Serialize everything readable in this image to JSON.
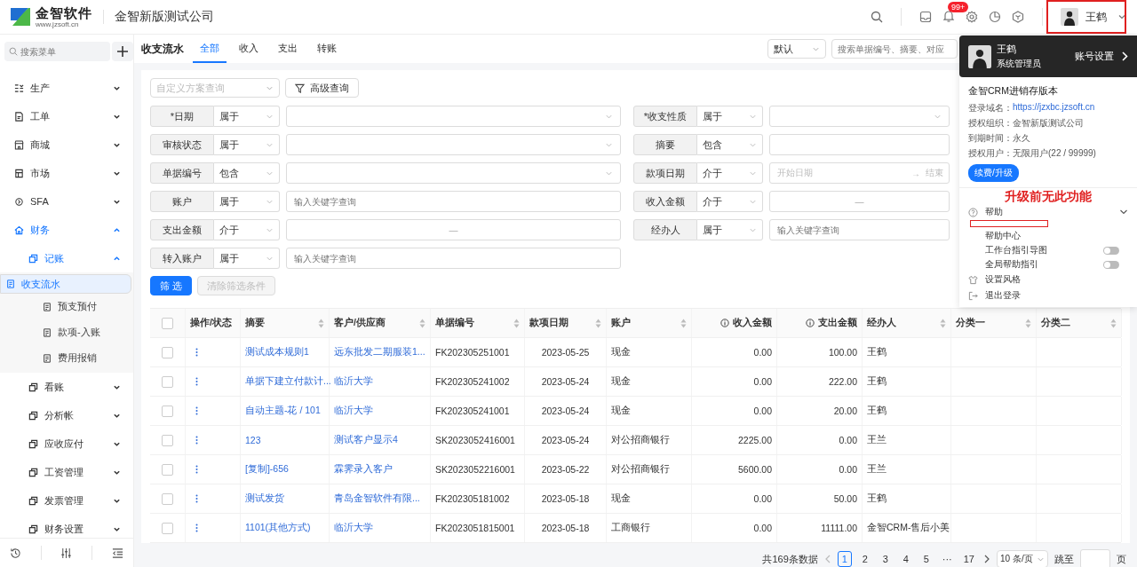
{
  "header": {
    "brand": "金智软件",
    "brand_url": "www.jzsoft.cn",
    "company": "金智新版测试公司",
    "notification_badge": "99+",
    "user": "王鹤"
  },
  "sidebar": {
    "search_placeholder": "搜索菜单",
    "items": [
      {
        "label": "生产",
        "expanded": false
      },
      {
        "label": "工单",
        "expanded": false
      },
      {
        "label": "商城",
        "expanded": false
      },
      {
        "label": "市场",
        "expanded": false
      },
      {
        "label": "SFA",
        "expanded": false
      },
      {
        "label": "财务",
        "expanded": true,
        "children": [
          {
            "label": "记账",
            "expanded": true,
            "children": [
              {
                "label": "收支流水",
                "selected": true
              },
              {
                "label": "预支预付",
                "selected": false
              },
              {
                "label": "款项-入账",
                "selected": false
              },
              {
                "label": "费用报销",
                "selected": false
              }
            ]
          },
          {
            "label": "看账",
            "expanded": false
          },
          {
            "label": "分析帐",
            "expanded": false
          },
          {
            "label": "应收应付",
            "expanded": false
          },
          {
            "label": "工资管理",
            "expanded": false
          },
          {
            "label": "发票管理",
            "expanded": false
          },
          {
            "label": "财务设置",
            "expanded": false
          }
        ]
      }
    ]
  },
  "page": {
    "title": "收支流水",
    "tabs": [
      {
        "label": "全部",
        "selected": true
      },
      {
        "label": "收入",
        "selected": false
      },
      {
        "label": "支出",
        "selected": false
      },
      {
        "label": "转账",
        "selected": false
      }
    ],
    "sort_select": "默认",
    "search_placeholder": "搜索单据编号、摘要、对应"
  },
  "filter": {
    "scheme_placeholder": "自定义方案查询",
    "advanced_button": "高级查询",
    "left": [
      {
        "label": "*日期",
        "operator": "属于",
        "kind": "select"
      },
      {
        "label": "审核状态",
        "operator": "属于",
        "kind": "select"
      },
      {
        "label": "单据编号",
        "operator": "包含",
        "kind": "select"
      },
      {
        "label": "账户",
        "operator": "属于",
        "kind": "input",
        "placeholder": "输入关键字查询"
      },
      {
        "label": "支出金额",
        "operator": "介于",
        "kind": "range",
        "separator": "—"
      },
      {
        "label": "转入账户",
        "operator": "属于",
        "kind": "input",
        "placeholder": "输入关键字查询"
      }
    ],
    "right": [
      {
        "label": "*收支性质",
        "operator": "属于",
        "kind": "select"
      },
      {
        "label": "摘要",
        "operator": "包含",
        "kind": "input"
      },
      {
        "label": "款项日期",
        "operator": "介于",
        "kind": "date",
        "start_placeholder": "开始日期",
        "separator": "→",
        "end_placeholder": "结束"
      },
      {
        "label": "收入金额",
        "operator": "介于",
        "kind": "range",
        "separator": "—"
      },
      {
        "label": "经办人",
        "operator": "属于",
        "kind": "input",
        "placeholder": "输入关键字查询"
      }
    ],
    "apply_button": "筛 选",
    "clear_button": {
      "label": "清除筛选条件",
      "disabled": true
    }
  },
  "table": {
    "all_checked": false,
    "columns": [
      {
        "label": "操作/状态",
        "sortable": false,
        "info": false
      },
      {
        "label": "摘要",
        "sortable": true,
        "info": false
      },
      {
        "label": "客户/供应商",
        "sortable": true,
        "info": false
      },
      {
        "label": "单据编号",
        "sortable": true,
        "info": false
      },
      {
        "label": "款项日期",
        "sortable": true,
        "info": false
      },
      {
        "label": "账户",
        "sortable": true,
        "info": false
      },
      {
        "label": "收入金额",
        "sortable": false,
        "info": true
      },
      {
        "label": "支出金额",
        "sortable": false,
        "info": true
      },
      {
        "label": "经办人",
        "sortable": true,
        "info": false
      },
      {
        "label": "分类一",
        "sortable": true,
        "info": false
      },
      {
        "label": "分类二",
        "sortable": true,
        "info": false
      }
    ],
    "rows": [
      {
        "checked": false,
        "cells": [
          "",
          "测试成本规则1",
          "远东批发二期服装1...",
          "FK202305251001",
          "2023-05-25",
          "现金",
          "0.00",
          "100.00",
          "王鹤"
        ]
      },
      {
        "checked": false,
        "cells": [
          "",
          "单据下建立付款计...",
          "临沂大学",
          "FK202305241002",
          "2023-05-24",
          "现金",
          "0.00",
          "222.00",
          "王鹤"
        ]
      },
      {
        "checked": false,
        "cells": [
          "",
          "自动主题-花 / 101",
          "临沂大学",
          "FK202305241001",
          "2023-05-24",
          "现金",
          "0.00",
          "20.00",
          "王鹤"
        ]
      },
      {
        "checked": false,
        "cells": [
          "",
          "123",
          "测试客户显示4",
          "SK2023052416001",
          "2023-05-24",
          "对公招商银行",
          "2225.00",
          "0.00",
          "王兰"
        ]
      },
      {
        "checked": false,
        "cells": [
          "",
          "[复制]-656",
          "霖霁录入客户",
          "SK2023052216001",
          "2023-05-22",
          "对公招商银行",
          "5600.00",
          "0.00",
          "王兰"
        ]
      },
      {
        "checked": false,
        "cells": [
          "",
          "测试发货",
          "青岛金智软件有限...",
          "FK202305181002",
          "2023-05-18",
          "现金",
          "0.00",
          "50.00",
          "王鹤"
        ]
      },
      {
        "checked": false,
        "cells": [
          "",
          "1101(其他方式)",
          "临沂大学",
          "FK2023051815001",
          "2023-05-18",
          "工商银行",
          "0.00",
          "11111.00",
          "金智CRM-售后小美"
        ]
      }
    ]
  },
  "pagination": {
    "total": "共169条数据",
    "pages": [
      {
        "label": "1",
        "selected": true
      },
      {
        "label": "2",
        "selected": false
      },
      {
        "label": "3",
        "selected": false
      },
      {
        "label": "4",
        "selected": false
      },
      {
        "label": "5",
        "selected": false
      },
      {
        "label": "···",
        "selected": false
      },
      {
        "label": "17",
        "selected": false
      }
    ],
    "page_size": "10 条/页",
    "jump_label": "跳至",
    "page_suffix": "页"
  },
  "user_menu": {
    "name": "王鹤",
    "role": "系统管理员",
    "settings_link": "账号设置",
    "edition": "金智CRM进销存版本",
    "info": [
      {
        "label": "登录域名：",
        "value": "https://jzxbc.jzsoft.cn",
        "kind": "link"
      },
      {
        "label": "授权组织：",
        "value": "金智新版测试公司",
        "kind": "text"
      },
      {
        "label": "到期时间：",
        "value": "永久",
        "kind": "text"
      },
      {
        "label": "授权用户：",
        "value": "无限用户(22 / 99999)",
        "kind": "text"
      }
    ],
    "upgrade_button": "续费/升级",
    "items": [
      {
        "label": "帮助",
        "expanded": true,
        "children": [
          {
            "label": "帮助中心",
            "kind": "link"
          },
          {
            "label": "工作台指引导图",
            "kind": "toggle",
            "on": false
          },
          {
            "label": "全局帮助指引",
            "kind": "toggle",
            "on": false
          }
        ]
      },
      {
        "label": "设置风格"
      },
      {
        "label": "退出登录"
      }
    ]
  },
  "annotation": {
    "text": "升级前无此功能"
  }
}
